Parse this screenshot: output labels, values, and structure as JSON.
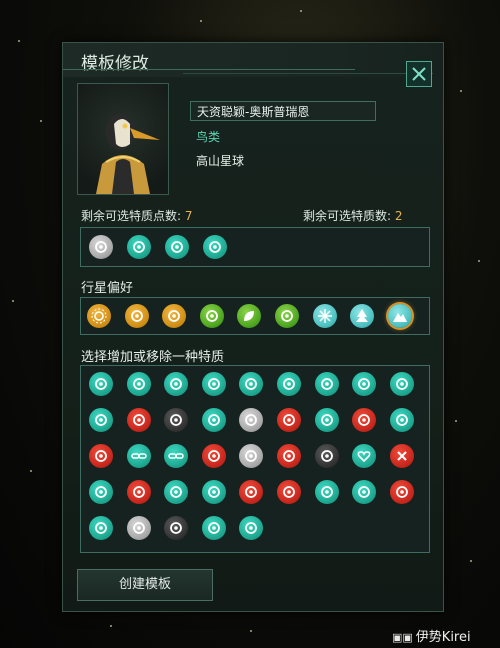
{
  "window": {
    "title": "模板修改"
  },
  "species": {
    "name": "天资聪颖-奥斯普瑞恩",
    "class": "鸟类",
    "homeworld": "高山星球"
  },
  "points": {
    "trait_points_label": "剩余可选特质点数:",
    "trait_points_value": "7",
    "trait_picks_label": "剩余可选特质数:",
    "trait_picks_value": "2"
  },
  "selected_traits": [
    {
      "icon": "gear-hand-icon",
      "color": "gray"
    },
    {
      "icon": "dna-icon",
      "color": "teal"
    },
    {
      "icon": "seedling-icon",
      "color": "teal"
    },
    {
      "icon": "circle-dots-icon",
      "color": "teal"
    }
  ],
  "planet_pref": {
    "label": "行星偏好",
    "items": [
      {
        "icon": "sun-icon",
        "color": "orange"
      },
      {
        "icon": "cactus-icon",
        "color": "orange"
      },
      {
        "icon": "savanna-tree-icon",
        "color": "orange"
      },
      {
        "icon": "palm-icon",
        "color": "green"
      },
      {
        "icon": "leaf-icon",
        "color": "green"
      },
      {
        "icon": "ocean-wave-icon",
        "color": "green"
      },
      {
        "icon": "snowflake-icon",
        "color": "lblue"
      },
      {
        "icon": "pine-tree-icon",
        "color": "lblue"
      },
      {
        "icon": "mountain-icon",
        "color": "lblue",
        "selected": true
      }
    ]
  },
  "trait_grid": {
    "label": "选择增加或移除一种特质",
    "items": [
      {
        "icon": "tools-icon",
        "color": "teal"
      },
      {
        "icon": "people-icon",
        "color": "teal"
      },
      {
        "icon": "hand-shake-icon",
        "color": "teal"
      },
      {
        "icon": "graduation-cap-icon",
        "color": "teal"
      },
      {
        "icon": "piggy-bank-icon",
        "color": "teal"
      },
      {
        "icon": "gear-icon",
        "color": "teal"
      },
      {
        "icon": "atom-icon",
        "color": "teal"
      },
      {
        "icon": "globe-icon",
        "color": "teal"
      },
      {
        "icon": "spiral-icon",
        "color": "teal"
      },
      {
        "icon": "spiral-icon",
        "color": "teal"
      },
      {
        "icon": "cycle-icon",
        "color": "red"
      },
      {
        "icon": "turtle-icon",
        "color": "dark"
      },
      {
        "icon": "medal-icon",
        "color": "teal"
      },
      {
        "icon": "cylinder-icon",
        "color": "gray"
      },
      {
        "icon": "cylinder-icon",
        "color": "red"
      },
      {
        "icon": "chat-icon",
        "color": "teal"
      },
      {
        "icon": "chat-x-icon",
        "color": "red"
      },
      {
        "icon": "rhino-icon",
        "color": "teal"
      },
      {
        "icon": "rock-hand-icon",
        "color": "red"
      },
      {
        "icon": "chain-icon",
        "color": "teal"
      },
      {
        "icon": "chain-icon",
        "color": "teal"
      },
      {
        "icon": "chain-broken-icon",
        "color": "red"
      },
      {
        "icon": "hiker-icon",
        "color": "gray"
      },
      {
        "icon": "mountain-range-icon",
        "color": "red"
      },
      {
        "icon": "island-icon",
        "color": "dark"
      },
      {
        "icon": "heart-icon",
        "color": "teal"
      },
      {
        "icon": "x-icon",
        "color": "red"
      },
      {
        "icon": "bird-icon",
        "color": "teal"
      },
      {
        "icon": "bird-icon",
        "color": "red"
      },
      {
        "icon": "elephant-icon",
        "color": "teal"
      },
      {
        "icon": "elephant-icon",
        "color": "teal"
      },
      {
        "icon": "elephant-icon",
        "color": "red"
      },
      {
        "icon": "rope-icon",
        "color": "red"
      },
      {
        "icon": "croissant-icon",
        "color": "teal"
      },
      {
        "icon": "recycle-icon",
        "color": "teal"
      },
      {
        "icon": "mech-hand-icon",
        "color": "red"
      },
      {
        "icon": "fork-plant-icon",
        "color": "teal"
      },
      {
        "icon": "heart-x-icon",
        "color": "gray"
      },
      {
        "icon": "rabbit-icon",
        "color": "dark"
      },
      {
        "icon": "bricks-icon",
        "color": "teal"
      },
      {
        "icon": "brain-icon",
        "color": "teal"
      }
    ]
  },
  "buttons": {
    "create": "创建模板"
  },
  "watermark": {
    "text": "伊势Kirei",
    "logo": "bilibili-logo"
  }
}
